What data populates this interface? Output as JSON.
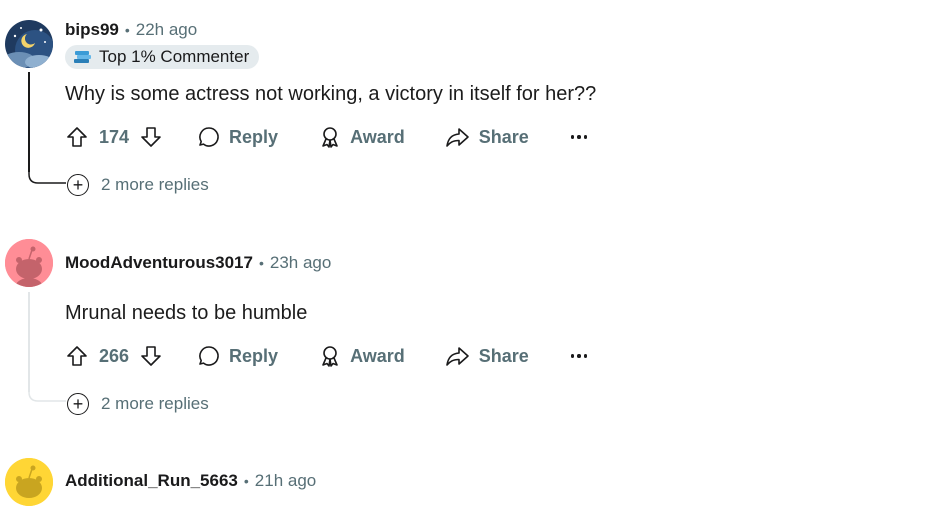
{
  "comments": [
    {
      "username": "bips99",
      "separator": "•",
      "time": "22h ago",
      "badge": "Top 1% Commenter",
      "body": "Why is some actress not working, a victory in itself for her??",
      "votes": "174",
      "reply_label": "Reply",
      "award_label": "Award",
      "share_label": "Share",
      "more_replies": "2 more replies"
    },
    {
      "username": "MoodAdventurous3017",
      "separator": "•",
      "time": "23h ago",
      "body": "Mrunal needs to be humble",
      "votes": "266",
      "reply_label": "Reply",
      "award_label": "Award",
      "share_label": "Share",
      "more_replies": "2 more replies"
    },
    {
      "username": "Additional_Run_5663",
      "separator": "•",
      "time": "21h ago"
    }
  ],
  "colors": {
    "meta_text": "#576f76",
    "badge_bg": "#e5ebee",
    "thread_line": "#e2e6e8",
    "avatar2_bg": "#ff8d96",
    "avatar3_bg": "#ffd635"
  }
}
